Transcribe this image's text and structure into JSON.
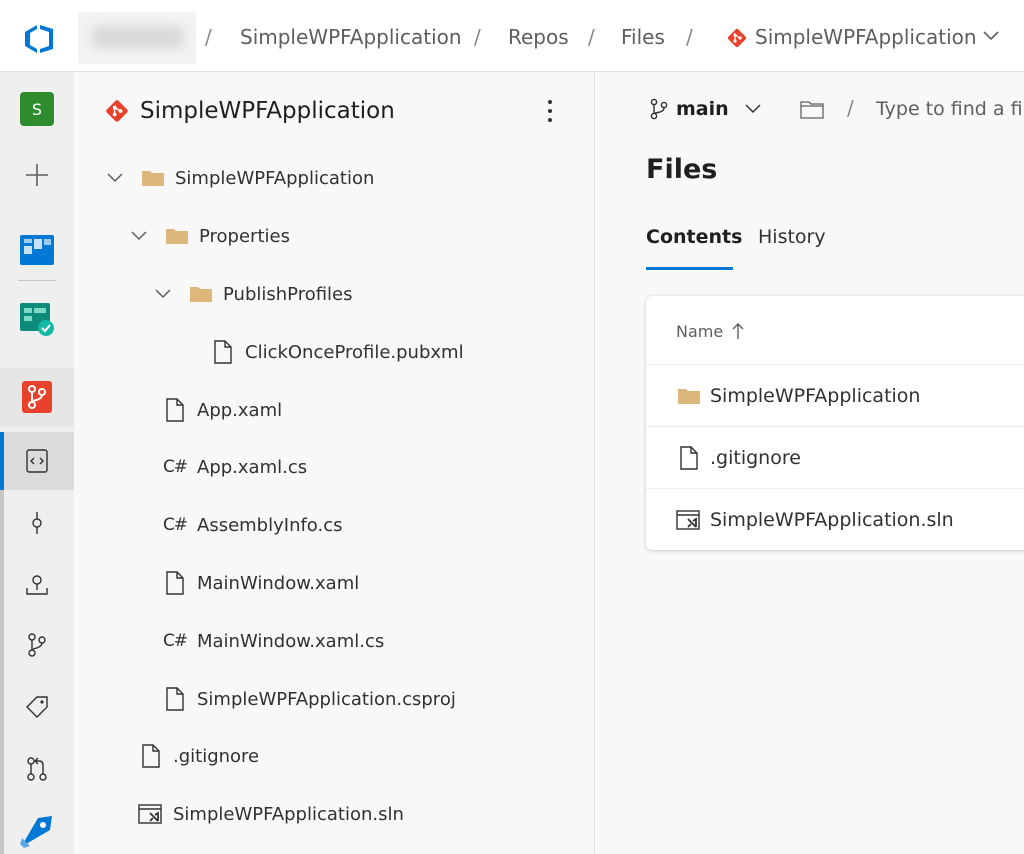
{
  "breadcrumb": {
    "project": "SimpleWPFApplication",
    "section": "Repos",
    "page": "Files",
    "repo": "SimpleWPFApplication"
  },
  "rail": {
    "project_initial": "S",
    "items": [
      "project-avatar",
      "new-icon",
      "boards-icon",
      "test-plans-icon",
      "repos-icon",
      "files-icon",
      "commits-icon",
      "pushes-icon",
      "branches-icon",
      "tags-icon",
      "pull-requests-icon",
      "pipelines-icon"
    ]
  },
  "tree": {
    "repo_name": "SimpleWPFApplication",
    "nodes": [
      {
        "label": "SimpleWPFApplication",
        "type": "folder",
        "depth": 0,
        "expanded": true
      },
      {
        "label": "Properties",
        "type": "folder",
        "depth": 1,
        "expanded": true
      },
      {
        "label": "PublishProfiles",
        "type": "folder",
        "depth": 2,
        "expanded": true
      },
      {
        "label": "ClickOnceProfile.pubxml",
        "type": "file",
        "depth": 3
      },
      {
        "label": "App.xaml",
        "type": "file",
        "depth": 1
      },
      {
        "label": "App.xaml.cs",
        "type": "csharp",
        "depth": 1
      },
      {
        "label": "AssemblyInfo.cs",
        "type": "csharp",
        "depth": 1
      },
      {
        "label": "MainWindow.xaml",
        "type": "file",
        "depth": 1
      },
      {
        "label": "MainWindow.xaml.cs",
        "type": "csharp",
        "depth": 1
      },
      {
        "label": "SimpleWPFApplication.csproj",
        "type": "file",
        "depth": 1
      },
      {
        "label": ".gitignore",
        "type": "file",
        "depth": 0
      },
      {
        "label": "SimpleWPFApplication.sln",
        "type": "solution",
        "depth": 0
      }
    ],
    "csharp_icon_text": "C#"
  },
  "main": {
    "branch": "main",
    "path_separator": "/",
    "path_placeholder": "Type to find a file or folder...",
    "title": "Files",
    "tabs": [
      {
        "label": "Contents",
        "active": true
      },
      {
        "label": "History",
        "active": false
      }
    ],
    "table": {
      "column_name": "Name",
      "sort": "ascending",
      "rows": [
        {
          "name": "SimpleWPFApplication",
          "type": "folder"
        },
        {
          "name": ".gitignore",
          "type": "file"
        },
        {
          "name": "SimpleWPFApplication.sln",
          "type": "solution"
        }
      ]
    }
  },
  "colors": {
    "accent": "#0078d4",
    "git": "#e8412c",
    "folder": "#dcb67a",
    "project_avatar": "#2e8b2e"
  }
}
